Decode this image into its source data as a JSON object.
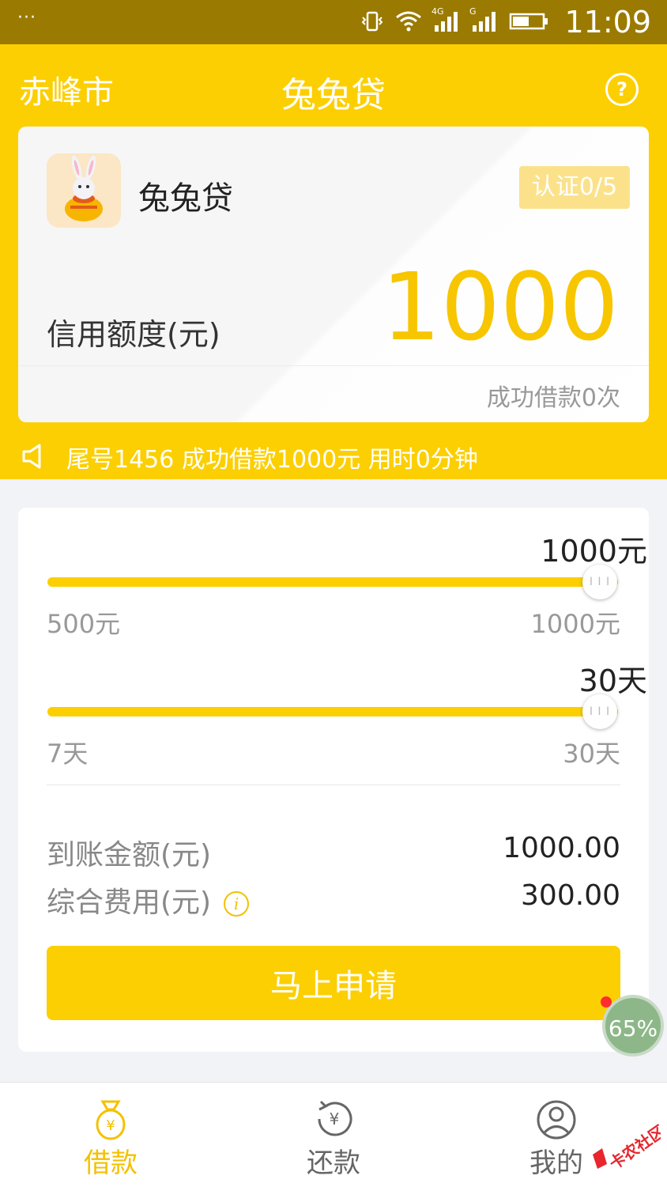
{
  "status_bar": {
    "menu": "···",
    "time": "11:09",
    "network_1": "4G",
    "network_2": "G"
  },
  "header": {
    "city": "赤峰市",
    "title": "兔兔贷",
    "help": "?"
  },
  "card": {
    "app_name": "兔兔贷",
    "cert_label": "认证0/5",
    "credit_label": "信用额度(元)",
    "credit_amount": "1000",
    "success_count": "成功借款0次"
  },
  "notice": {
    "text": "尾号1456 成功借款1000元 用时0分钟"
  },
  "amount_slider": {
    "value_label": "1000元",
    "value": 1000,
    "min_label": "500元",
    "max_label": "1000元"
  },
  "days_slider": {
    "value_label": "30天",
    "value": 30,
    "min_label": "7天",
    "max_label": "30天"
  },
  "summary": {
    "received_label": "到账金额(元)",
    "received_value": "1000.00",
    "fee_label": "综合费用(元)",
    "fee_icon": "i",
    "fee_value": "300.00"
  },
  "apply_button": "马上申请",
  "float_ball": "65%",
  "tabs": [
    {
      "label": "借款",
      "icon": "money-bag-icon",
      "active": true
    },
    {
      "label": "还款",
      "icon": "repay-icon",
      "active": false
    },
    {
      "label": "我的",
      "icon": "user-icon",
      "active": false
    }
  ],
  "watermark": "卡农社区",
  "colors": {
    "accent": "#fccf02",
    "status_bar": "#9a7a00",
    "amount": "#f7c600",
    "active_tab": "#f3c100",
    "inactive_tab": "#666666"
  }
}
